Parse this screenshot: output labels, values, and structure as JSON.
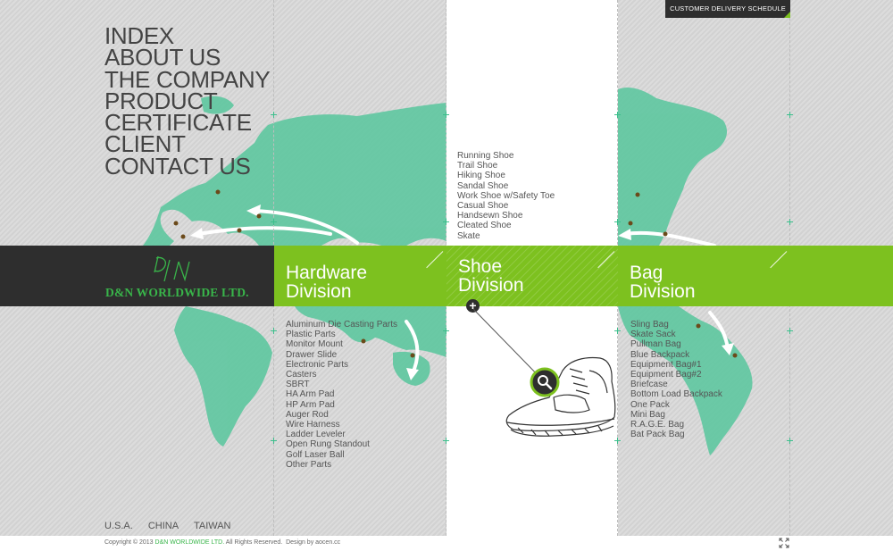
{
  "nav": {
    "items": [
      "INDEX",
      "ABOUT US",
      "THE COMPANY",
      "PRODUCT",
      "CERTIFICATE",
      "CLIENT",
      "CONTACT US"
    ]
  },
  "top_button": {
    "label": "CUSTOMER DELIVERY SCHEDULE"
  },
  "logo": {
    "text": "D&N WORLDWIDE LTD.",
    "monogram": "D/N"
  },
  "divisions": {
    "hardware": {
      "title_line1": "Hardware",
      "title_line2": "Division",
      "items": [
        "Aluminum Die Casting Parts",
        "Plastic Parts",
        "Monitor Mount",
        "Drawer Slide",
        "Electronic Parts",
        "Casters",
        "SBRT",
        "HA Arm Pad",
        "HP Arm Pad",
        "Auger Rod",
        "Wire Harness",
        "Ladder Leveler",
        "Open Rung Standout",
        "Golf Laser Ball",
        "Other Parts"
      ]
    },
    "shoe": {
      "title_line1": "Shoe",
      "title_line2": "Division",
      "items": [
        "Running Shoe",
        "Trail Shoe",
        "Hiking Shoe",
        "Sandal Shoe",
        "Work Shoe w/Safety Toe",
        "Casual Shoe",
        "Handsewn Shoe",
        "Cleated Shoe",
        "Skate"
      ]
    },
    "bag": {
      "title_line1": "Bag",
      "title_line2": "Division",
      "items": [
        "Sling Bag",
        "Skate Sack",
        "Pullman Bag",
        "Blue Backpack",
        "Equipment Bag#1",
        "Equipment Bag#2",
        "Briefcase",
        "Bottom Load Backpack",
        "One Pack",
        "Mini Bag",
        "R.A.G.E. Bag",
        "Bat Pack Bag"
      ]
    }
  },
  "countries": [
    "U.S.A.",
    "CHINA",
    "TAIWAN"
  ],
  "footer": {
    "copyright_prefix": "Copyright © 2013",
    "brand": "D&N WORLDWIDE LTD.",
    "rights": "All Rights Reserved.",
    "design": "Design by aocen.cc"
  },
  "colors": {
    "accent": "#7dc11f",
    "dark": "#2e2e2e",
    "map": "#5cc9a0"
  },
  "icons": {
    "plus": "plus-icon",
    "magnifier": "magnifier-icon",
    "expand": "expand-icon"
  }
}
